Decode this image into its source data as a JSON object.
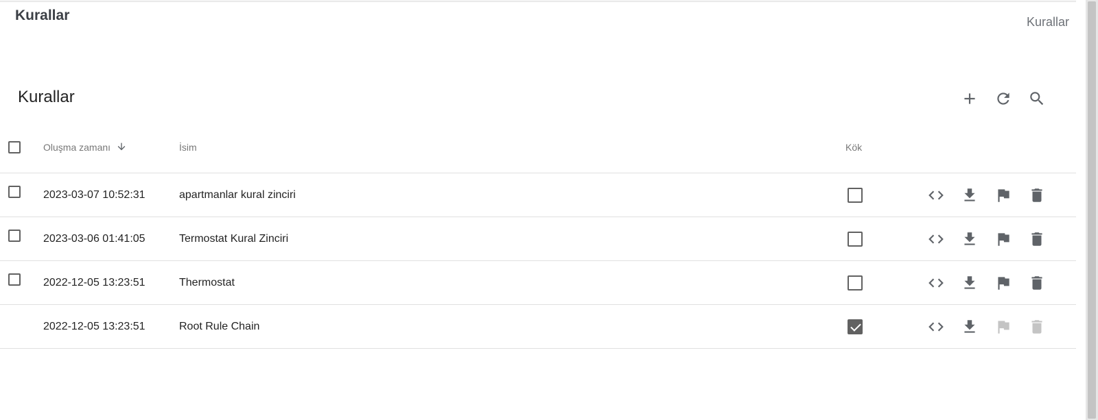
{
  "page": {
    "title": "Kurallar",
    "breadcrumb": "Kurallar"
  },
  "card": {
    "title": "Kurallar"
  },
  "toolbar": {
    "add_icon": "add-icon",
    "refresh_icon": "refresh-icon",
    "search_icon": "search-icon"
  },
  "table": {
    "columns": {
      "created": "Oluşma zamanı",
      "name": "İsim",
      "root": "Kök"
    },
    "sort": {
      "column": "created",
      "direction": "desc"
    },
    "rows": [
      {
        "created": "2023-03-07 10:52:31",
        "name": "apartmanlar kural zinciri",
        "root": false,
        "selectable": true
      },
      {
        "created": "2023-03-06 01:41:05",
        "name": "Termostat Kural Zinciri",
        "root": false,
        "selectable": true
      },
      {
        "created": "2022-12-05 13:23:51",
        "name": "Thermostat",
        "root": false,
        "selectable": true
      },
      {
        "created": "2022-12-05 13:23:51",
        "name": "Root Rule Chain",
        "root": true,
        "selectable": false
      }
    ]
  },
  "row_actions": [
    "code-icon",
    "download-icon",
    "flag-icon",
    "delete-icon"
  ],
  "colors": {
    "icon": "#5f6368",
    "disabled": "#c4c4c4",
    "divider": "#e0e0e0"
  }
}
